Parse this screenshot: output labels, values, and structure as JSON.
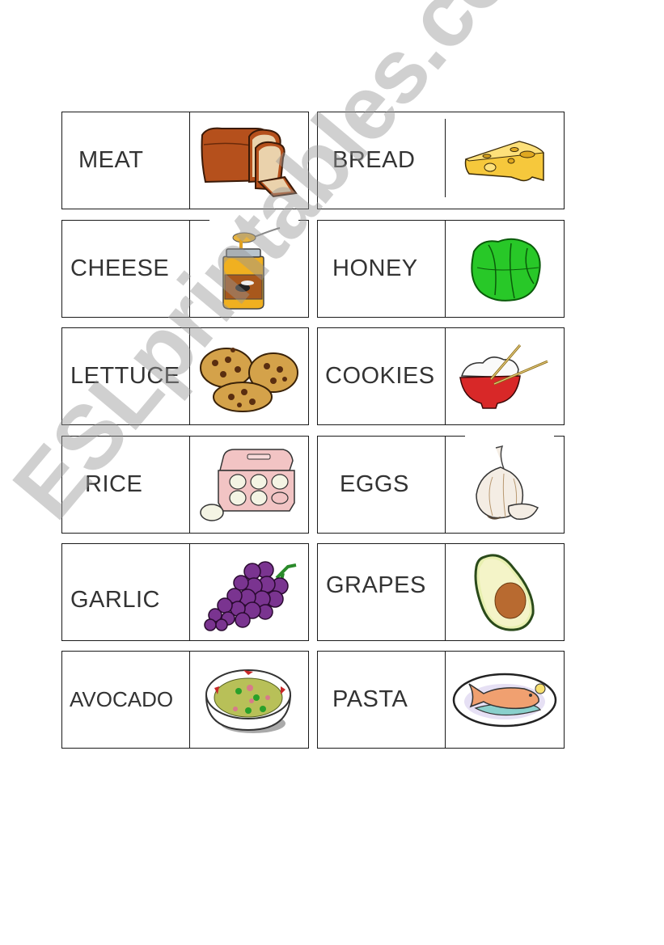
{
  "worksheet": {
    "cards": [
      {
        "word": "MEAT",
        "picture": "bread-loaf-icon"
      },
      {
        "word": "BREAD",
        "picture": "cheese-wedge-icon"
      },
      {
        "word": "CHEESE",
        "picture": "honey-jar-icon"
      },
      {
        "word": "HONEY",
        "picture": "lettuce-icon"
      },
      {
        "word": "LETTUCE",
        "picture": "cookies-icon"
      },
      {
        "word": "COOKIES",
        "picture": "rice-bowl-icon"
      },
      {
        "word": "RICE",
        "picture": "egg-carton-icon"
      },
      {
        "word": "EGGS",
        "picture": "garlic-icon"
      },
      {
        "word": "GARLIC",
        "picture": "grapes-icon"
      },
      {
        "word": "GRAPES",
        "picture": "avocado-icon"
      },
      {
        "word": "AVOCADO",
        "picture": "pasta-bowl-icon"
      },
      {
        "word": "PASTA",
        "picture": "fish-plate-icon"
      }
    ]
  },
  "watermark": {
    "text": "ESLprintables.com"
  }
}
